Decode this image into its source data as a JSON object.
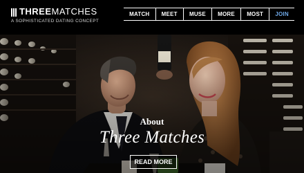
{
  "brand": {
    "name_bold": "THREE",
    "name_light": "MATCHES",
    "tagline": "A SOPHISTICATED DATING CONCEPT"
  },
  "nav": {
    "items": [
      {
        "label": "MATCH"
      },
      {
        "label": "MEET"
      },
      {
        "label": "MUSE"
      },
      {
        "label": "MORE"
      },
      {
        "label": "MOST"
      },
      {
        "label": "JOIN"
      }
    ]
  },
  "hero": {
    "kicker": "About",
    "title": "Three Matches",
    "cta": "READ MORE"
  },
  "colors": {
    "background": "#000000",
    "accent_join": "#6fa9e8"
  }
}
